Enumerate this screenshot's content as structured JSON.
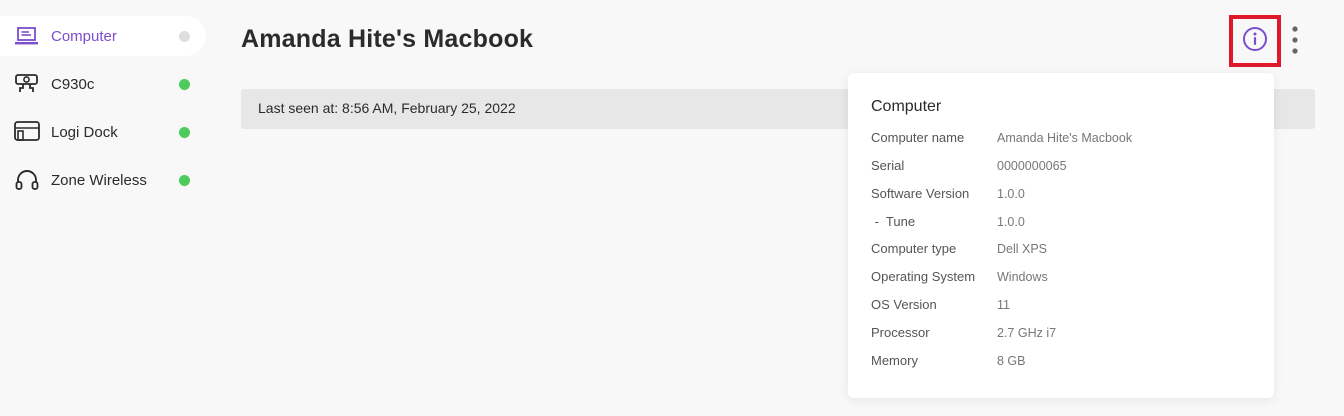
{
  "sidebar": {
    "items": [
      {
        "label": "Computer",
        "icon": "laptop-icon",
        "status_color": "#dedede",
        "active": true
      },
      {
        "label": "C930c",
        "icon": "webcam-icon",
        "status_color": "#4ccb5c",
        "active": false
      },
      {
        "label": "Logi Dock",
        "icon": "dock-icon",
        "status_color": "#4ccb5c",
        "active": false
      },
      {
        "label": "Zone Wireless",
        "icon": "headset-icon",
        "status_color": "#4ccb5c",
        "active": false
      }
    ]
  },
  "header": {
    "title": "Amanda Hite's Macbook"
  },
  "last_seen": {
    "text": "Last seen at: 8:56 AM, February 25, 2022"
  },
  "toolbar": {
    "info_icon": "info-icon",
    "more_icon": "more-vertical-icon",
    "accent_color": "#7c4dcf",
    "highlight_color": "#e0182b"
  },
  "info_popup": {
    "title": "Computer",
    "rows": [
      {
        "key": "Computer name",
        "value": "Amanda Hite's Macbook"
      },
      {
        "key": "Serial",
        "value": "0000000065"
      },
      {
        "key": "Software Version",
        "value": "1.0.0"
      },
      {
        "key": " -  Tune",
        "value": "1.0.0"
      },
      {
        "key": "Computer type",
        "value": "Dell XPS"
      },
      {
        "key": "Operating System",
        "value": "Windows"
      },
      {
        "key": "OS Version",
        "value": "11"
      },
      {
        "key": "Processor",
        "value": "2.7 GHz i7"
      },
      {
        "key": "Memory",
        "value": "8 GB"
      }
    ]
  }
}
